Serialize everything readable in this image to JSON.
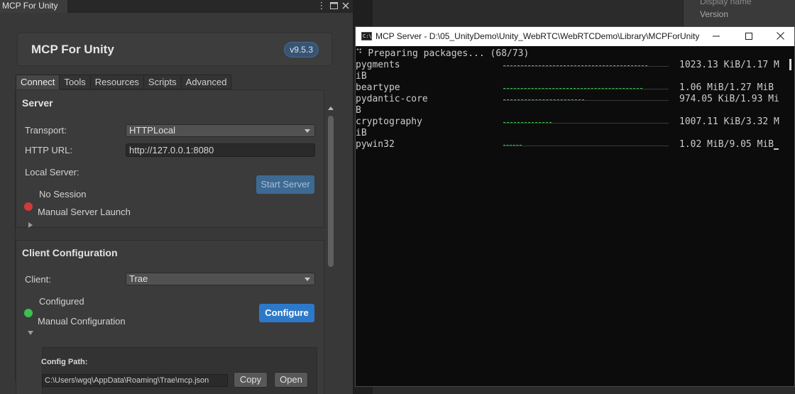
{
  "unity": {
    "window_tab": "MCP For Unity",
    "titlebar_icons": [
      "kebab-menu-icon",
      "maximize-icon",
      "close-icon"
    ],
    "header": {
      "title": "MCP For Unity",
      "version": "v9.5.3"
    },
    "tabs": [
      {
        "label": "Connect",
        "active": true
      },
      {
        "label": "Tools",
        "active": false
      },
      {
        "label": "Resources",
        "active": false
      },
      {
        "label": "Scripts",
        "active": false
      },
      {
        "label": "Advanced",
        "active": false
      }
    ],
    "server": {
      "title": "Server",
      "transport_label": "Transport:",
      "transport_value": "HTTPLocal",
      "http_url_label": "HTTP URL:",
      "http_url_value": "http://127.0.0.1:8080",
      "local_server_label": "Local Server:",
      "start_server_button": "Start Server",
      "status_text": "No Session",
      "status_color": "#d23a3a",
      "manual_launch_label": "Manual Server Launch"
    },
    "client": {
      "title": "Client Configuration",
      "client_label": "Client:",
      "client_value": "Trae",
      "status_text": "Configured",
      "status_color": "#3bc24e",
      "configure_button": "Configure",
      "manual_config_label": "Manual Configuration",
      "config_path_label": "Config Path:",
      "config_path_value": "C:\\Users\\wgq\\AppData\\Roaming\\Trae\\mcp.json",
      "copy_button": "Copy",
      "open_button": "Open"
    }
  },
  "background": {
    "display_name_label": "Display name",
    "version_label": "Version"
  },
  "terminal": {
    "title": "MCP Server - D:\\05_UnityDemo\\Unity_WebRTC\\WebRTCDemo\\Library\\MCPForUnity...",
    "header_line": "⠙ Preparing packages... (68/73)",
    "packages": [
      {
        "name": "pygments",
        "progress": 0.87,
        "size": "1023.13 KiB/1.17 M",
        "wrap": "iB"
      },
      {
        "name": "beartype",
        "progress": 0.84,
        "size": "1.06 MiB/1.27 MiB",
        "wrap": ""
      },
      {
        "name": "pydantic-core",
        "progress": 0.49,
        "size": "974.05 KiB/1.93 Mi",
        "wrap": "B"
      },
      {
        "name": "cryptography",
        "progress": 0.29,
        "size": "1007.11 KiB/3.32 M",
        "wrap": "iB"
      },
      {
        "name": "pywin32",
        "progress": 0.11,
        "size": "1.02 MiB/9.05 MiB",
        "wrap": ""
      }
    ],
    "accent_color": "#31c744"
  }
}
